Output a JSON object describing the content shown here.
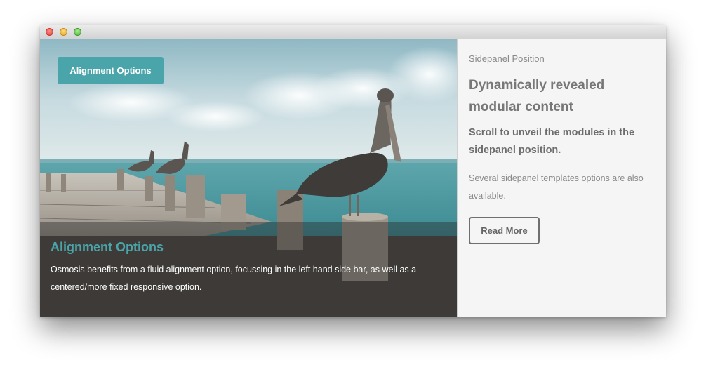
{
  "hero": {
    "button_label": "Alignment Options",
    "caption_title": "Alignment Options",
    "caption_text": "Osmosis benefits from a fluid alignment option, focussing in the left hand side bar, as well as a centered/more fixed responsive option."
  },
  "sidepanel": {
    "eyebrow": "Sidepanel Position",
    "title": "Dynamically revealed modular content",
    "subtitle": "Scroll to unveil the modules in the sidepanel position.",
    "body": "Several sidepanel templates options are also available.",
    "button_label": "Read More"
  },
  "colors": {
    "accent": "#4aa5ab",
    "panel_background": "#f5f5f5"
  }
}
